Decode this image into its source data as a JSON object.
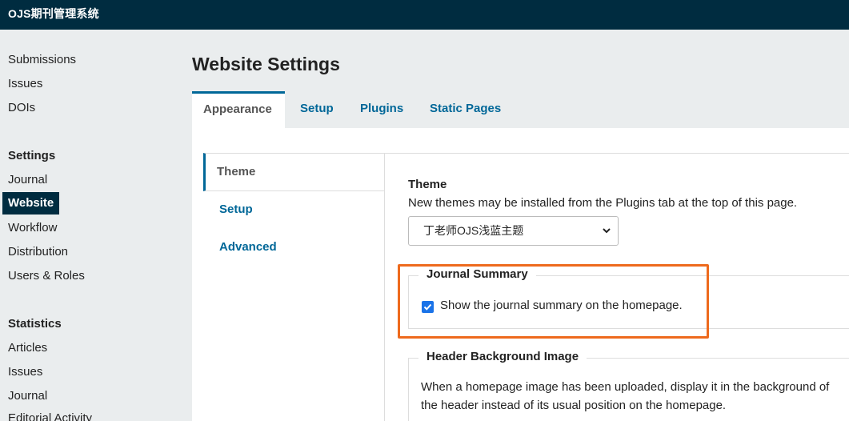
{
  "app": {
    "title": "OJS期刊管理系统"
  },
  "sidebar": {
    "items": [
      {
        "label": "Submissions"
      },
      {
        "label": "Issues"
      },
      {
        "label": "DOIs"
      }
    ],
    "settings_heading": "Settings",
    "settings_items": [
      {
        "label": "Journal"
      },
      {
        "label": "Website",
        "active": true
      },
      {
        "label": "Workflow"
      },
      {
        "label": "Distribution"
      },
      {
        "label": "Users & Roles"
      }
    ],
    "statistics_heading": "Statistics",
    "statistics_items": [
      {
        "label": "Articles"
      },
      {
        "label": "Issues"
      },
      {
        "label": "Journal"
      },
      {
        "label": "Editorial Activity"
      }
    ]
  },
  "main": {
    "title": "Website Settings",
    "tabs": [
      {
        "label": "Appearance",
        "active": true
      },
      {
        "label": "Setup"
      },
      {
        "label": "Plugins"
      },
      {
        "label": "Static Pages"
      }
    ],
    "subtabs": [
      {
        "label": "Theme",
        "active": true
      },
      {
        "label": "Setup"
      },
      {
        "label": "Advanced"
      }
    ]
  },
  "theme_section": {
    "label": "Theme",
    "description": "New themes may be installed from the Plugins tab at the top of this page.",
    "selected_theme": "丁老师OJS浅蓝主题"
  },
  "journal_summary": {
    "legend": "Journal Summary",
    "checkbox_label": "Show the journal summary on the homepage.",
    "checked": true
  },
  "header_background": {
    "legend": "Header Background Image",
    "description": "When a homepage image has been uploaded, display it in the background of the header instead of its usual position on the homepage."
  },
  "colors": {
    "topbar": "#002c40",
    "accent": "#006798",
    "highlight": "#ee6a1d",
    "checkbox": "#1a73e8"
  }
}
